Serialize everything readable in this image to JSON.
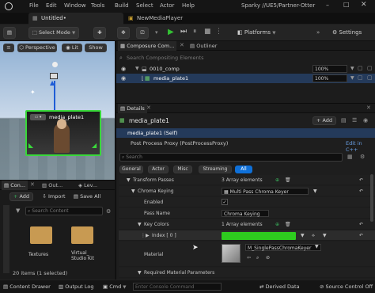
{
  "app": {
    "title": "Sparky //UE5/Partner-Otter",
    "menu": [
      "File",
      "Edit",
      "Window",
      "Tools",
      "Build",
      "Select",
      "Actor",
      "Help"
    ],
    "tabs": [
      {
        "label": "Untitled•"
      },
      {
        "label": "NewMediaPlayer"
      }
    ]
  },
  "toolbar": {
    "select_mode": "Select Mode",
    "platforms": "Platforms",
    "settings": "Settings"
  },
  "viewport": {
    "perspective": "Perspective",
    "lit": "Lit",
    "show": "Show",
    "plate_label": "media_plate1"
  },
  "composure": {
    "tab_label": "Composure Com...",
    "outliner_label": "Outliner",
    "search_placeholder": "Search Compositing Elements",
    "rows": [
      {
        "name": "0010_comp",
        "percent": "100%"
      },
      {
        "name": "media_plate1",
        "percent": "100%"
      }
    ]
  },
  "details": {
    "tab_label": "Details",
    "header_title": "media_plate1",
    "add_label": "+ Add",
    "self_row": "media_plate1 (Self)",
    "post_process": "Post Process Proxy (PostProcessProxy)",
    "edit_in_cpp": "Edit in C++",
    "search_placeholder": "Search",
    "filter_tabs": [
      "General",
      "Actor",
      "Misc",
      "Streaming",
      "All"
    ],
    "active_filter": "All",
    "properties": {
      "transform_passes": {
        "label": "Transform Passes",
        "value": "3 Array elements"
      },
      "chroma_keying": {
        "label": "Chroma Keying",
        "value": "Multi Pass Chroma Keyer"
      },
      "enabled": {
        "label": "Enabled"
      },
      "pass_name": {
        "label": "Pass Name",
        "value": "Chroma Keying"
      },
      "key_colors": {
        "label": "Key Colors",
        "value": "1 Array elements"
      },
      "index": {
        "label": "Index [ 0 ]",
        "color": "#2ecc1f"
      },
      "material": {
        "label": "Material",
        "value": "M_SinglePassChromaKeyer"
      },
      "required_params": {
        "label": "Required Material Parameters"
      }
    }
  },
  "content_browser": {
    "tabs": [
      "Con...",
      "Out...",
      "Lev..."
    ],
    "add_label": "Add",
    "import_label": "Import",
    "save_all_label": "Save All",
    "search_placeholder": "Search Content",
    "items": [
      {
        "name": "Textures"
      },
      {
        "name": "Virtual_\nStudio Kit"
      }
    ],
    "status": "20 items (1 selected)"
  },
  "statusbar": {
    "content_drawer": "Content Drawer",
    "output_log": "Output Log",
    "cmd": "Cmd",
    "console_placeholder": "Enter Console Command",
    "derived_data": "Derived Data",
    "source_control": "Source Control Off"
  },
  "colors": {
    "accent_blue": "#0f70d8",
    "selection_row": "#243a5a",
    "key_green": "#2ecc1f",
    "play_green": "#34c134"
  }
}
